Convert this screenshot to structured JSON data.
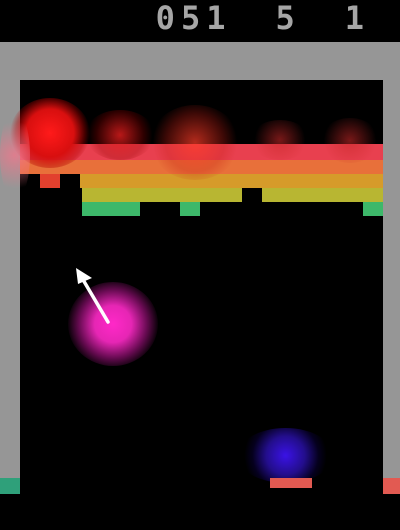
{
  "hud": {
    "score": "051",
    "lives": "5",
    "player": "1"
  },
  "colors": {
    "wall": "#969696",
    "row_red": "#e8404f",
    "row_orange": "#e8703a",
    "row_amber": "#d69b2a",
    "row_yellow": "#b8b632",
    "row_green": "#3db86a",
    "paddle": "#e25a52",
    "ball_glow": "#e626b4",
    "trail_glow": "#3a12e6"
  },
  "icons": {
    "direction": "arrow-icon"
  }
}
